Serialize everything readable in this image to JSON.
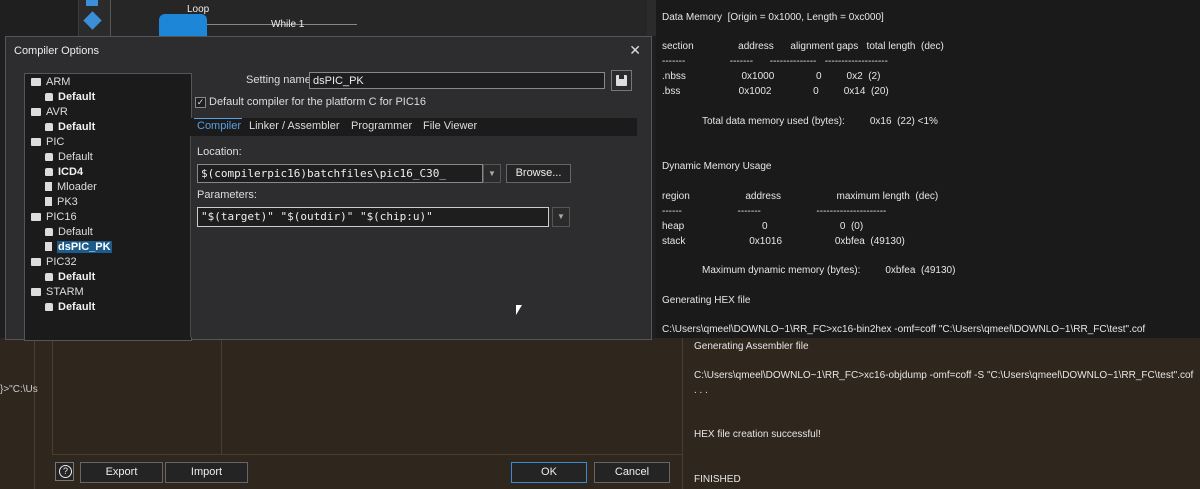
{
  "flowchart": {
    "loop_label": "Loop",
    "while_label": "While 1"
  },
  "output": {
    "lines": [
      "Data Memory  [Origin = 0x1000, Length = 0xc000]",
      "section                address      alignment gaps   total length  (dec)",
      "-------                -------      --------------   -------------------",
      ".nbss                    0x1000               0         0x2  (2)",
      ".bss                     0x1002               0         0x14  (20)",
      "Total data memory used (bytes):         0x16  (22) <1%",
      "Dynamic Memory Usage",
      "region                    address                    maximum length  (dec)",
      "------                    -------                    ---------------------",
      "heap                            0                          0  (0)",
      "stack                       0x1016                   0xbfea  (49130)",
      "Maximum dynamic memory (bytes):         0xbfea  (49130)",
      "Generating HEX file",
      "C:\\Users\\qmeel\\DOWNLO~1\\RR_FC>xc16-bin2hex -omf=coff \"C:\\Users\\qmeel\\DOWNLO~1\\RR_FC\\test\".cof"
    ],
    "bottom_lines": [
      "Generating Assembler file",
      "C:\\Users\\qmeel\\DOWNLO~1\\RR_FC>xc16-objdump -omf=coff -S \"C:\\Users\\qmeel\\DOWNLO~1\\RR_FC\\test\".cof",
      ". . .",
      "HEX file creation successful!",
      "FINISHED"
    ]
  },
  "left_pane_fragment": "}>\"C:\\Us",
  "dialog": {
    "title": "Compiler Options",
    "close_glyph": "✕",
    "tree": [
      {
        "label": "ARM",
        "kind": "folder"
      },
      {
        "label": "Default",
        "kind": "lock",
        "bold": true
      },
      {
        "label": "AVR",
        "kind": "folder"
      },
      {
        "label": "Default",
        "kind": "lock",
        "bold": true
      },
      {
        "label": "PIC",
        "kind": "folder"
      },
      {
        "label": "Default",
        "kind": "lock"
      },
      {
        "label": "ICD4",
        "kind": "lock",
        "bold": true
      },
      {
        "label": "Mloader",
        "kind": "doc"
      },
      {
        "label": "PK3",
        "kind": "doc"
      },
      {
        "label": "PIC16",
        "kind": "folder"
      },
      {
        "label": "Default",
        "kind": "lock"
      },
      {
        "label": "dsPIC_PK",
        "kind": "doc",
        "selected": true,
        "bold": true
      },
      {
        "label": "PIC32",
        "kind": "folder"
      },
      {
        "label": "Default",
        "kind": "lock",
        "bold": true
      },
      {
        "label": "STARM",
        "kind": "folder"
      },
      {
        "label": "Default",
        "kind": "lock",
        "bold": true
      }
    ],
    "setting_name_label": "Setting name:",
    "setting_name_value": "dsPIC_PK",
    "default_checkbox_label": "Default compiler for the platform C for PIC16",
    "default_checked": true,
    "tabs": [
      "Compiler",
      "Linker / Assembler",
      "Programmer",
      "File Viewer"
    ],
    "active_tab": "Compiler",
    "location_label": "Location:",
    "location_value": "$(compilerpic16)batchfiles\\pic16_C30_",
    "browse_label": "Browse...",
    "parameters_label": "Parameters:",
    "parameters_value": "\"$(target)\" \"$(outdir)\" \"$(chip:u)\""
  },
  "footer": {
    "help_glyph": "?",
    "export_label": "Export",
    "import_label": "Import",
    "ok_label": "OK",
    "cancel_label": "Cancel"
  }
}
